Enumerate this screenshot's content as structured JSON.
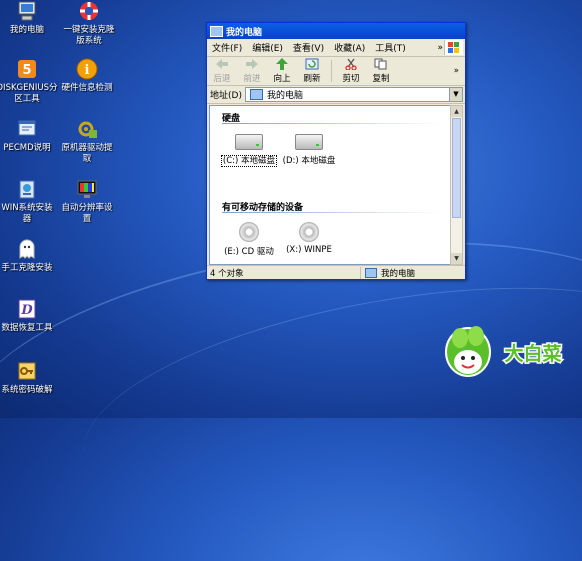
{
  "desktop": {
    "icons": [
      {
        "label": "我的电脑",
        "icon": "computer-icon"
      },
      {
        "label": "一键安装克隆\n版系统",
        "icon": "lifebuoy-icon"
      },
      {
        "label": "DISKGENIUS分\n区工具",
        "icon": "diskgenius-icon"
      },
      {
        "label": "硬件信息检测",
        "icon": "info-icon"
      },
      {
        "label": "PECMD说明",
        "icon": "pecmd-icon"
      },
      {
        "label": "原机器驱动提\n取",
        "icon": "driver-icon"
      },
      {
        "label": "WIN系统安装\n器",
        "icon": "installer-icon"
      },
      {
        "label": "自动分辨率设\n置",
        "icon": "resolution-icon"
      },
      {
        "label": "手工克隆安装",
        "icon": "ghost-icon"
      },
      {
        "label": "数据恢复工具",
        "icon": "recovery-icon"
      },
      {
        "label": "系统密码破解",
        "icon": "key-icon"
      }
    ]
  },
  "window": {
    "title": "我的电脑",
    "menu": [
      "文件(F)",
      "编辑(E)",
      "查看(V)",
      "收藏(A)",
      "工具(T)"
    ],
    "menu_more": "»",
    "toolbar": [
      {
        "label": "后退",
        "icon": "back-arrow-icon",
        "enabled": false
      },
      {
        "label": "前进",
        "icon": "forward-arrow-icon",
        "enabled": false
      },
      {
        "label": "向上",
        "icon": "up-arrow-icon",
        "enabled": true
      },
      {
        "label": "刷新",
        "icon": "refresh-icon",
        "enabled": true
      },
      {
        "label": "剪切",
        "icon": "scissors-icon",
        "enabled": true
      },
      {
        "label": "复制",
        "icon": "copy-icon",
        "enabled": true
      }
    ],
    "toolbar_more": "»",
    "address_label": "地址(D)",
    "address_value": "我的电脑",
    "groups": {
      "hard_disks": "硬盘",
      "removable": "有可移动存储的设备"
    },
    "drives": [
      {
        "label": "(C:) 本地磁盘",
        "selected": true
      },
      {
        "label": "(D:) 本地磁盘",
        "selected": false
      }
    ],
    "removable_drives": [
      {
        "label": "(E:) CD 驱动"
      },
      {
        "label": "(X:) WINPE"
      }
    ],
    "status_left": "4 个对象",
    "status_right": "我的电脑"
  },
  "brand": {
    "text": "大白菜",
    "color": "#ffffff"
  }
}
